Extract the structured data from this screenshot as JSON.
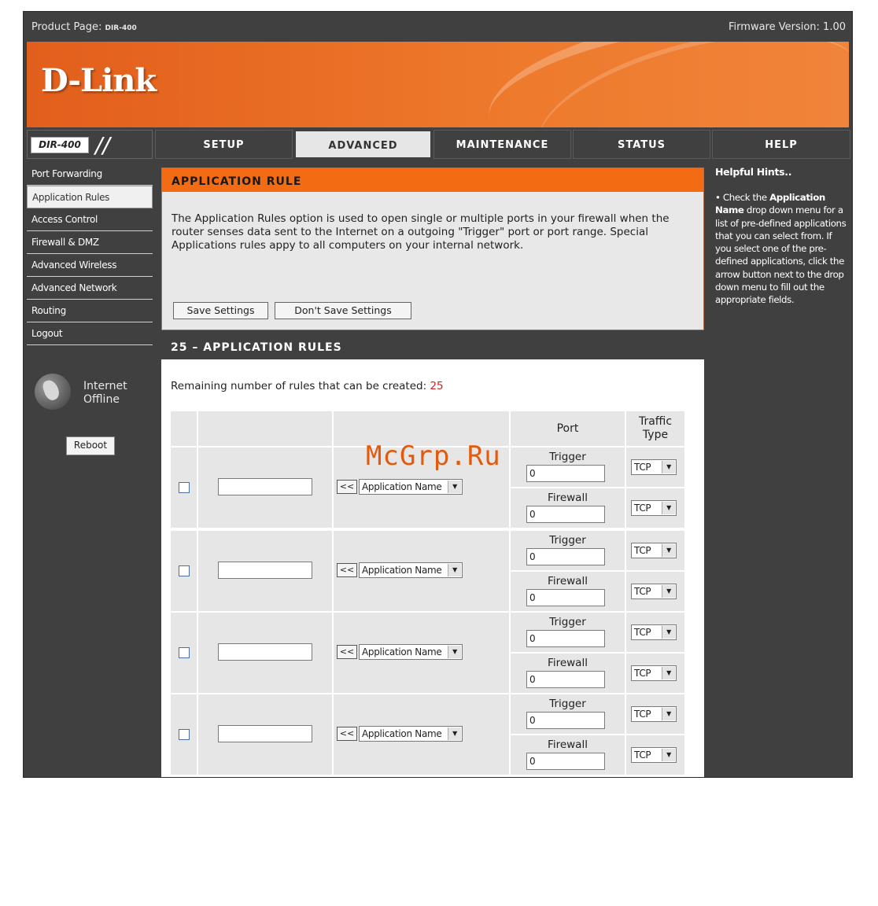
{
  "topbar": {
    "product_label": "Product Page:",
    "model_small": "DIR-400",
    "firmware": "Firmware Version: 1.00"
  },
  "brand": {
    "logo": "D-Link"
  },
  "model_box": "DIR-400",
  "nav_tabs": [
    {
      "label": "SETUP"
    },
    {
      "label": "ADVANCED",
      "active": true
    },
    {
      "label": "MAINTENANCE"
    },
    {
      "label": "STATUS"
    },
    {
      "label": "HELP"
    }
  ],
  "sidebar": {
    "items": [
      {
        "label": "Port Forwarding"
      },
      {
        "label": "Application Rules",
        "active": true
      },
      {
        "label": "Access Control"
      },
      {
        "label": "Firewall & DMZ"
      },
      {
        "label": "Advanced Wireless"
      },
      {
        "label": "Advanced Network"
      },
      {
        "label": "Routing"
      },
      {
        "label": "Logout"
      }
    ],
    "internet_line1": "Internet",
    "internet_line2": "Offline",
    "reboot_label": "Reboot"
  },
  "app_rule": {
    "title": "APPLICATION RULE",
    "description": "The Application Rules option is used to open single or multiple ports in your firewall when the router senses data sent to the Internet on a outgoing \"Trigger\" port or port range. Special Applications rules appy to all computers on your internal network.",
    "save_label": "Save Settings",
    "dont_save_label": "Don't Save Settings"
  },
  "rules": {
    "title": "25 – APPLICATION RULES",
    "remaining_label": "Remaining number of rules that can be created:",
    "remaining_value": "25",
    "header_port": "Port",
    "header_traffic_1": "Traffic",
    "header_traffic_2": "Type",
    "trigger_label": "Trigger",
    "firewall_label": "Firewall",
    "arrow_label": "<<",
    "app_select": "Application Name",
    "rows": [
      {
        "trigger": "0",
        "firewall": "0",
        "trigger_type": "TCP",
        "firewall_type": "TCP"
      },
      {
        "trigger": "0",
        "firewall": "0",
        "trigger_type": "TCP",
        "firewall_type": "TCP"
      },
      {
        "trigger": "0",
        "firewall": "0",
        "trigger_type": "TCP",
        "firewall_type": "TCP"
      },
      {
        "trigger": "0",
        "firewall": "0",
        "trigger_type": "TCP",
        "firewall_type": "TCP"
      }
    ]
  },
  "help": {
    "title": "Helpful Hints..",
    "bullet": "•",
    "text_a": " Check the ",
    "bold_a": "Application Name",
    "text_b": " drop down menu for a list of pre-defined applications that you can select from. If you select one of the pre-defined applications, click the arrow button next to the drop down menu to fill out the appropriate fields."
  },
  "watermark": "McGrp.Ru"
}
